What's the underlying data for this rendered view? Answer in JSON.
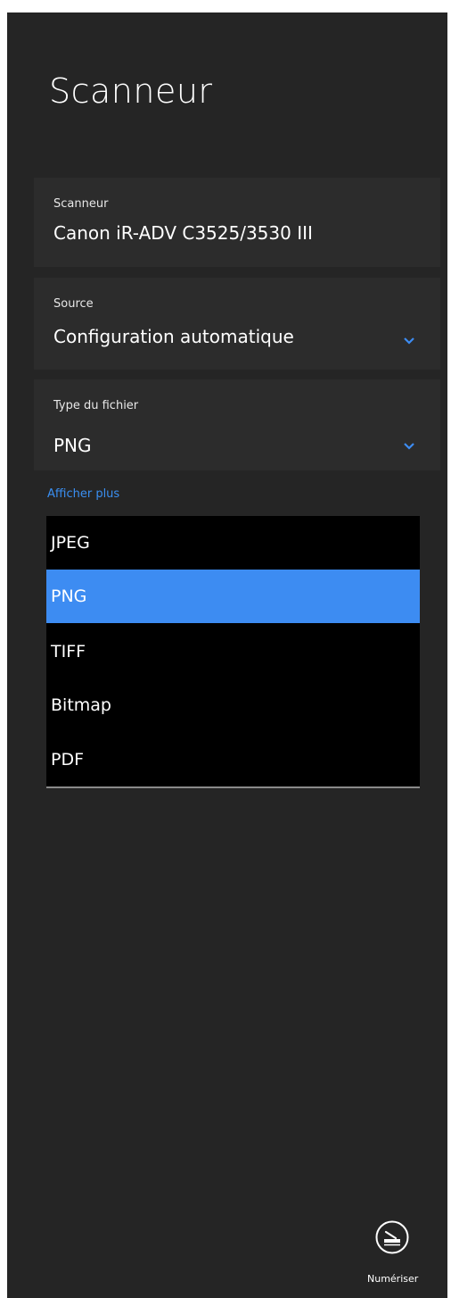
{
  "panel": {
    "title": "Scanneur"
  },
  "scanner": {
    "label": "Scanneur",
    "value": "Canon iR-ADV C3525/3530 III"
  },
  "source": {
    "label": "Source",
    "value": "Configuration automatique"
  },
  "file_type": {
    "label": "Type du fichier",
    "value": "PNG",
    "options": [
      "JPEG",
      "PNG",
      "TIFF",
      "Bitmap",
      "PDF"
    ],
    "selected": "PNG"
  },
  "show_more": {
    "label": "Afficher plus"
  },
  "scan_button": {
    "label": "Numériser",
    "icon": "scanner-icon"
  },
  "colors": {
    "panel_background": "#252525",
    "card_background": "#2c2c2c",
    "accent": "#3d8cf2",
    "link": "#3a8ff2",
    "dropdown_background": "#000000"
  }
}
